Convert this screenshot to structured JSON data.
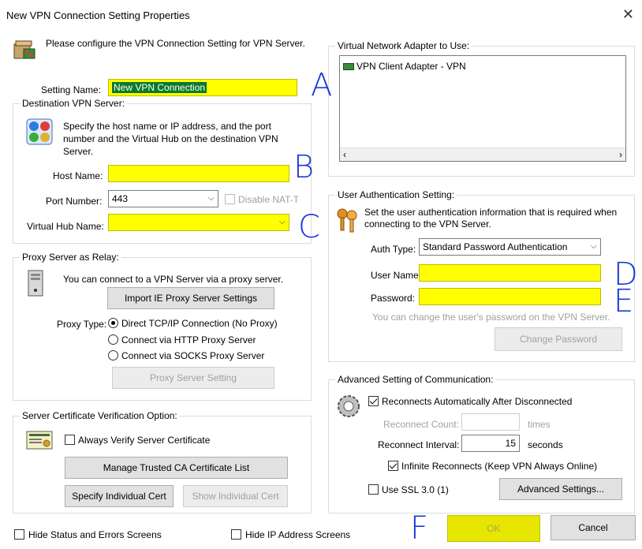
{
  "window": {
    "title": "New VPN Connection Setting Properties",
    "close_glyph": "✕"
  },
  "intro": {
    "text": "Please configure the VPN Connection Setting for VPN Server."
  },
  "setting_name": {
    "label": "Setting Name:",
    "value": "New VPN Connection"
  },
  "destination": {
    "group_label": "Destination VPN Server:",
    "description": "Specify the host name or IP address, and the port number and the Virtual Hub on the destination VPN Server.",
    "host_label": "Host Name:",
    "host_value": "",
    "port_label": "Port Number:",
    "port_value": "443",
    "disable_natt": "Disable NAT-T",
    "hub_label": "Virtual Hub Name:",
    "hub_value": ""
  },
  "proxy": {
    "group_label": "Proxy Server as Relay:",
    "description": "You can connect to a VPN Server via a proxy server.",
    "import_button": "Import IE Proxy Server Settings",
    "type_label": "Proxy Type:",
    "options": [
      "Direct TCP/IP Connection (No Proxy)",
      "Connect via HTTP Proxy Server",
      "Connect via SOCKS Proxy Server"
    ],
    "setting_button": "Proxy Server Setting"
  },
  "cert": {
    "group_label": "Server Certificate Verification Option:",
    "always_verify": "Always Verify Server Certificate",
    "manage_button": "Manage Trusted CA Certificate List",
    "specify_button": "Specify Individual Cert",
    "show_button": "Show Individual Cert"
  },
  "adapter": {
    "group_label": "Virtual Network Adapter to Use:",
    "item": "VPN Client Adapter - VPN"
  },
  "auth": {
    "group_label": "User Authentication Setting:",
    "description": "Set the user authentication information that is required when connecting to the VPN Server.",
    "type_label": "Auth Type:",
    "type_value": "Standard Password Authentication",
    "user_label": "User Name:",
    "user_value": "",
    "password_label": "Password:",
    "password_value": "",
    "hint": "You can change the user's password on the VPN Server.",
    "change_button": "Change Password"
  },
  "advanced": {
    "group_label": "Advanced Setting of Communication:",
    "reconnect_auto": "Reconnects Automatically After Disconnected",
    "reconnect_count_label": "Reconnect Count:",
    "reconnect_count_value": "",
    "times": "times",
    "interval_label": "Reconnect Interval:",
    "interval_value": "15",
    "seconds": "seconds",
    "infinite": "Infinite Reconnects (Keep VPN Always Online)",
    "use_ssl": "Use SSL 3.0 (1)",
    "settings_button": "Advanced Settings..."
  },
  "footer": {
    "hide_status": "Hide Status and Errors Screens",
    "hide_ip": "Hide IP Address Screens",
    "ok": "OK",
    "cancel": "Cancel"
  },
  "annotations": [
    "A",
    "B",
    "C",
    "D",
    "E",
    "F"
  ],
  "colors": {
    "highlight": "#ffff00",
    "annotation": "#1a3bd6"
  }
}
